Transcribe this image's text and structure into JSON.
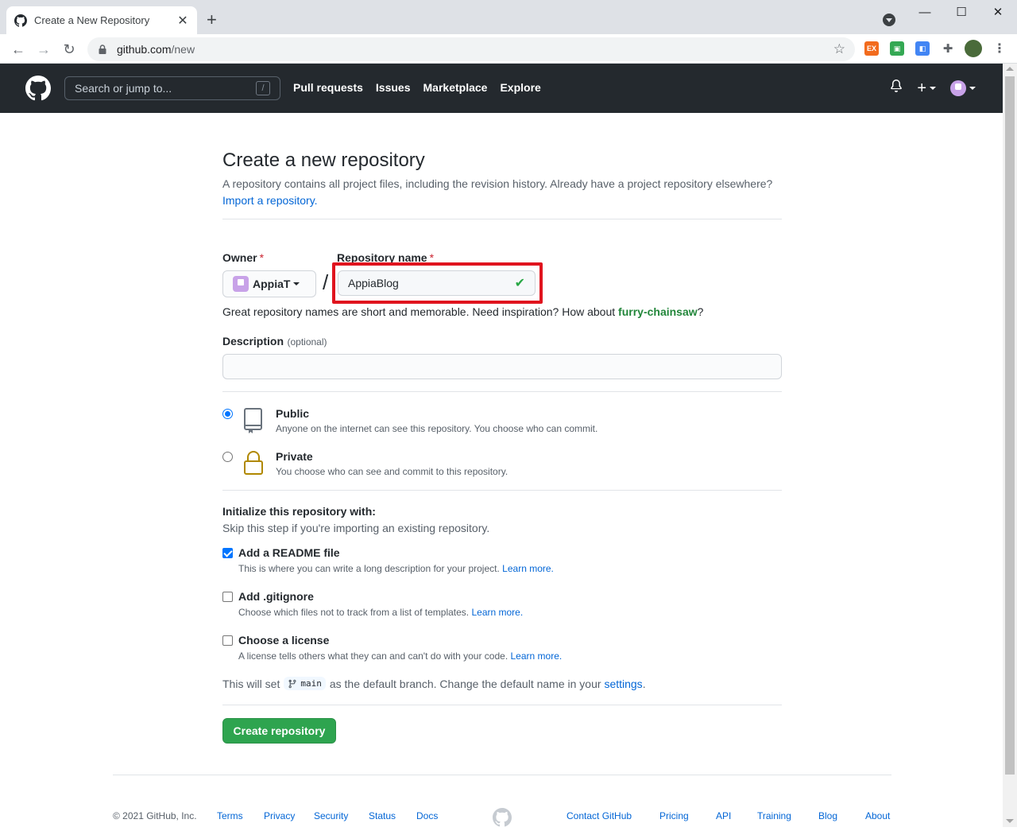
{
  "browser": {
    "tab_title": "Create a New Repository",
    "tab_close": "✕",
    "new_tab": "+",
    "url_host": "github.com",
    "url_path": "/new"
  },
  "header": {
    "search_placeholder": "Search or jump to...",
    "search_shortcut": "/",
    "nav": [
      "Pull requests",
      "Issues",
      "Marketplace",
      "Explore"
    ],
    "plus_label": "+"
  },
  "page": {
    "title": "Create a new repository",
    "lead": "A repository contains all project files, including the revision history. Already have a project repository elsewhere?",
    "import_link": "Import a repository.",
    "owner_label": "Owner",
    "required_mark": "*",
    "owner_value": "AppiaT",
    "separator": "/",
    "repo_label": "Repository name",
    "repo_value": "AppiaBlog",
    "hint_prefix": "Great repository names are short and memorable. Need inspiration? How about",
    "hint_suggestion": "furry-chainsaw",
    "hint_suffix": "?",
    "description_label": "Description",
    "description_optional": "(optional)",
    "description_value": "",
    "visibility": {
      "selected": "public",
      "public_title": "Public",
      "public_sub": "Anyone on the internet can see this repository. You choose who can commit.",
      "private_title": "Private",
      "private_sub": "You choose who can see and commit to this repository."
    },
    "init_title": "Initialize this repository with:",
    "init_sub": "Skip this step if you're importing an existing repository.",
    "options": [
      {
        "title": "Add a README file",
        "sub": "This is where you can write a long description for your project.",
        "link": "Learn more.",
        "checked": true
      },
      {
        "title": "Add .gitignore",
        "sub": "Choose which files not to track from a list of templates.",
        "link": "Learn more.",
        "checked": false
      },
      {
        "title": "Choose a license",
        "sub": "A license tells others what they can and can't do with your code.",
        "link": "Learn more.",
        "checked": false
      }
    ],
    "branch_prefix": "This will set",
    "branch_name": "main",
    "branch_middle": "as the default branch. Change the default name in your",
    "branch_link": "settings",
    "branch_end": ".",
    "create_button": "Create repository"
  },
  "footer": {
    "copyright": "© 2021 GitHub, Inc.",
    "left_links": [
      "Terms",
      "Privacy",
      "Security",
      "Status",
      "Docs"
    ],
    "right_links": [
      "Contact GitHub",
      "Pricing",
      "API",
      "Training",
      "Blog",
      "About"
    ]
  },
  "colors": {
    "header_bg": "#24292e",
    "link": "#0366d6",
    "create_button": "#2ea44f",
    "highlight_box": "#e0141e",
    "success_check": "#28a745"
  }
}
